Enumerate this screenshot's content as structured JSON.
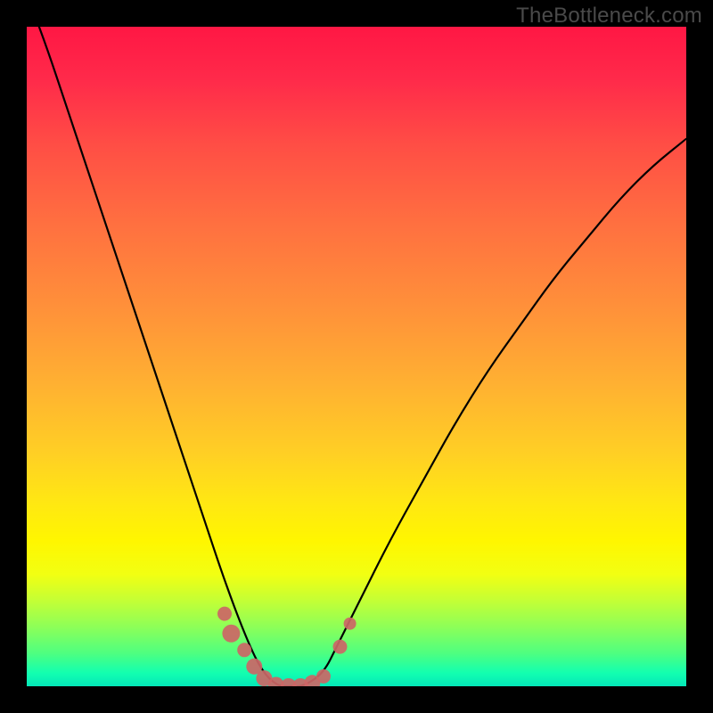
{
  "watermark_text": "TheBottleneck.com",
  "chart_data": {
    "type": "line",
    "title": "",
    "xlabel": "",
    "ylabel": "",
    "xlim": [
      0,
      1
    ],
    "ylim": [
      0,
      1
    ],
    "series": [
      {
        "name": "bottleneck-curve",
        "x": [
          0.0,
          0.03,
          0.06,
          0.09,
          0.12,
          0.15,
          0.18,
          0.21,
          0.24,
          0.27,
          0.3,
          0.33,
          0.355,
          0.38,
          0.4,
          0.42,
          0.45,
          0.47,
          0.5,
          0.55,
          0.6,
          0.65,
          0.7,
          0.75,
          0.8,
          0.85,
          0.9,
          0.95,
          1.0
        ],
        "y": [
          1.05,
          0.97,
          0.88,
          0.79,
          0.7,
          0.61,
          0.52,
          0.43,
          0.34,
          0.25,
          0.16,
          0.08,
          0.025,
          0.0,
          0.0,
          0.0,
          0.02,
          0.06,
          0.12,
          0.22,
          0.31,
          0.4,
          0.48,
          0.55,
          0.62,
          0.68,
          0.74,
          0.79,
          0.83
        ]
      }
    ],
    "markers": [
      {
        "x": 0.3,
        "y": 0.11,
        "r": 8
      },
      {
        "x": 0.31,
        "y": 0.08,
        "r": 10
      },
      {
        "x": 0.33,
        "y": 0.055,
        "r": 8
      },
      {
        "x": 0.345,
        "y": 0.03,
        "r": 9
      },
      {
        "x": 0.36,
        "y": 0.012,
        "r": 9
      },
      {
        "x": 0.378,
        "y": 0.002,
        "r": 9
      },
      {
        "x": 0.397,
        "y": 0.0,
        "r": 9
      },
      {
        "x": 0.415,
        "y": 0.0,
        "r": 9
      },
      {
        "x": 0.433,
        "y": 0.005,
        "r": 9
      },
      {
        "x": 0.45,
        "y": 0.015,
        "r": 8
      },
      {
        "x": 0.475,
        "y": 0.06,
        "r": 8
      },
      {
        "x": 0.49,
        "y": 0.095,
        "r": 7
      }
    ],
    "marker_color": "#cc6666",
    "curve_color": "#000000"
  }
}
